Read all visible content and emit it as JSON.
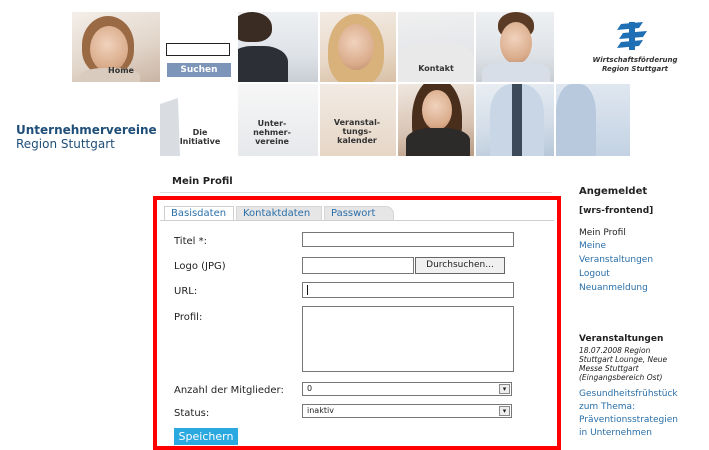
{
  "nav": {
    "home": "Home",
    "search_button": "Suchen",
    "search_value": "",
    "kontakt": "Kontakt",
    "initiative": [
      "Die",
      "Initiative"
    ],
    "unternehmervereine": [
      "Unter-",
      "nehmer-",
      "vereine"
    ],
    "veranstaltungskalender": [
      "Veranstal-",
      "tungs-",
      "kalender"
    ]
  },
  "brand": {
    "line1": "Unternehmervereine",
    "line2": "Region Stuttgart"
  },
  "logo": {
    "line1": "Wirtschaftsförderung",
    "line2": "Region Stuttgart",
    "color": "#1f6fb5"
  },
  "page": {
    "title": "Mein Profil"
  },
  "tabs": [
    {
      "label": "Basisdaten",
      "active": true
    },
    {
      "label": "Kontaktdaten",
      "active": false
    },
    {
      "label": "Passwort",
      "active": false
    }
  ],
  "form": {
    "titel_label": "Titel *:",
    "titel_value": "",
    "logo_label": "Logo (JPG)",
    "logo_value": "",
    "browse_button": "Durchsuchen...",
    "url_label": "URL:",
    "url_value": "",
    "profil_label": "Profil:",
    "profil_value": "",
    "mitglieder_label": "Anzahl der Mitglieder:",
    "mitglieder_value": "0",
    "status_label": "Status:",
    "status_value": "inaktiv",
    "save_button": "Speichern"
  },
  "sidebar": {
    "logged_in_heading": "Angemeldet",
    "user": "[wrs-frontend]",
    "current": "Mein Profil",
    "links": [
      "Meine",
      "Veranstaltungen",
      "Logout",
      "Neuanmeldung"
    ],
    "events_heading": "Veranstaltungen",
    "event_info": [
      "18.07.2008 Region",
      "Stuttgart Lounge, Neue",
      "Messe Stuttgart",
      "(Eingangsbereich Ost)"
    ],
    "event_links": [
      "Gesundheitsfrühstück",
      "zum Thema:",
      "Präventionsstrategien",
      "in Unternehmen"
    ]
  },
  "colors": {
    "accent": "#2aa8e0",
    "highlight_frame": "#ff0000",
    "brand": "#1f4e79",
    "link": "#2a6fa8"
  }
}
